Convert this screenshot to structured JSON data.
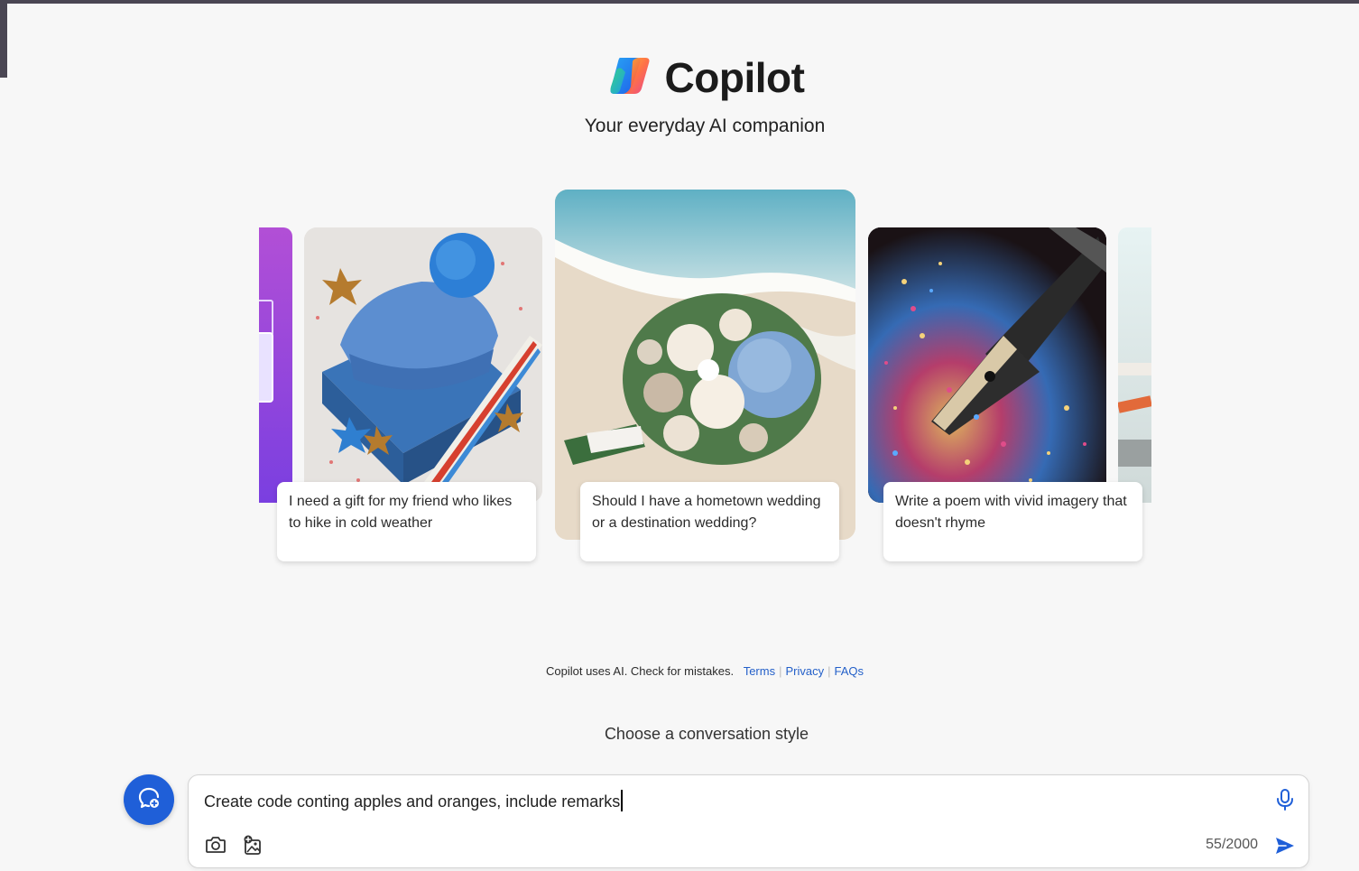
{
  "app": {
    "title": "Copilot",
    "tagline": "Your everyday AI companion"
  },
  "carousel": {
    "cards": [
      {
        "caption": "I need a gift for my friend who likes to hike in cold weather",
        "image": "blue-knit-hat-gift"
      },
      {
        "caption": "Should I have a hometown wedding or a destination wedding?",
        "image": "beach-wedding-bouquet"
      },
      {
        "caption": "Write a poem with vivid imagery that doesn't rhyme",
        "image": "fountain-pen-sparkles"
      }
    ]
  },
  "footer": {
    "disclaimer": "Copilot uses AI. Check for mistakes.",
    "links": {
      "terms": "Terms",
      "privacy": "Privacy",
      "faqs": "FAQs"
    },
    "style_label": "Choose a conversation style"
  },
  "composer": {
    "input_value": "Create code conting apples and oranges, include remarks",
    "char_count": "55/2000"
  },
  "icons": {
    "new_topic": "new-topic-icon",
    "mic": "microphone-icon",
    "camera": "camera-icon",
    "image_add": "add-image-icon",
    "send": "send-icon"
  },
  "colors": {
    "accent": "#1f5fd8",
    "link": "#2460c9",
    "background": "#f7f7f7"
  }
}
